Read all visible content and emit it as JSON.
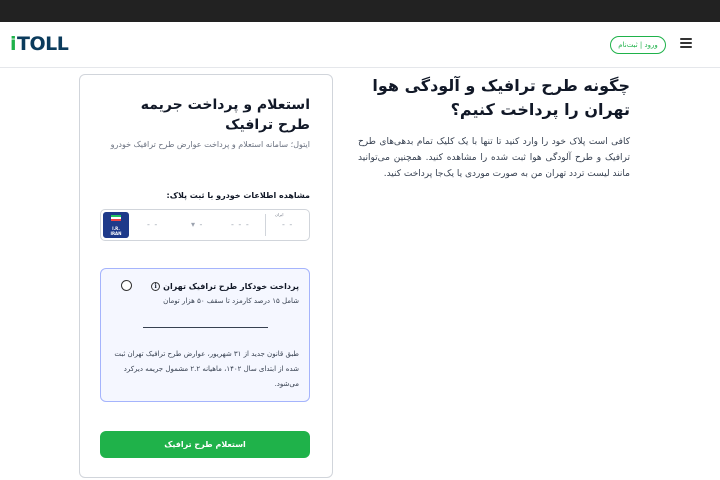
{
  "header": {
    "logo_i": "i",
    "logo_text": "TOLL",
    "login_label": "ورود | ثبت‌نام"
  },
  "form": {
    "title": "استعلام و پرداخت جریمه طرح ترافیک",
    "subtitle": "ایتول؛ سامانه استعلام و پرداخت عوارض طرح ترافیک خودرو",
    "plate_label": "مشاهده اطلاعات خودرو با ثبت پلاک:",
    "plate": {
      "flag_line1": "I.R.",
      "flag_line2": "IRAN",
      "region_label": "ایران",
      "field1": "- -",
      "field2": "▾ -",
      "field3": "- - -",
      "field4": "- -"
    },
    "auto_pay": {
      "title": "پرداخت خودکار طرح ترافیک تهران",
      "info_glyph": "i",
      "subtitle": "شامل ۱۵ درصد کارمزد تا سقف ۵۰ هزار تومان",
      "note": "طبق قانون جدید از ۳۱ شهریور، عوارض طرح ترافیک تهران ثبت شده از ابتدای سال ۱۴۰۲، ماهیانه ۲.۲ مشمول جریمه دیرکرد می‌شود."
    },
    "submit_label": "استعلام طرح ترافیک"
  },
  "article": {
    "title": "چگونه طرح ترافیک و آلودگی هوا تهران را پرداخت کنیم؟",
    "body": "کافی است پلاک خود را وارد کنید تا تنها با یک کلیک تمام بدهی‌های طرح ترافیک و طرح آلودگی هوا ثبت شده را مشاهده کنید. همچنین می‌توانید مانند لیست تردد تهران من به صورت موردی یا یک‌جا پرداخت کنید."
  },
  "colors": {
    "brand_green": "#1fb24a",
    "brand_navy": "#0b3b5c",
    "topbar": "#222222",
    "auto_box_border": "#a5b4fc"
  }
}
